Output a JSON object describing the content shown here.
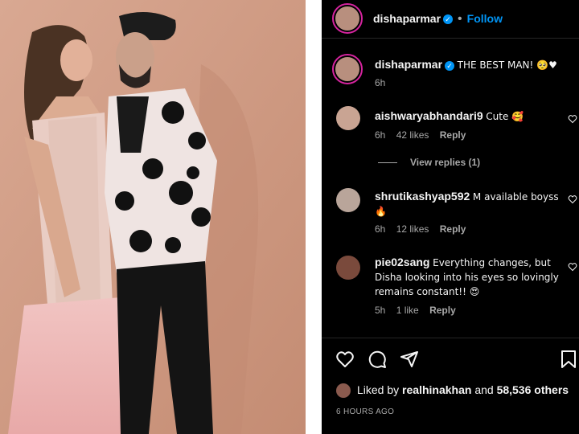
{
  "post": {
    "username": "dishaparmar",
    "follow_label": "Follow",
    "caption": "THE BEST MAN! 🥺♥",
    "caption_time": "6h"
  },
  "comments": [
    {
      "username": "aishwaryabhandari9",
      "text": "Cute 🥰",
      "time": "6h",
      "likes": "42 likes",
      "reply": "Reply"
    },
    {
      "username": "shrutikashyap592",
      "text": "M available boyss 🔥",
      "time": "6h",
      "likes": "12 likes",
      "reply": "Reply"
    },
    {
      "username": "pie02sang",
      "text": "Everything changes, but Disha looking into his eyes so lovingly remains constant!! 😍",
      "time": "5h",
      "likes": "1 like",
      "reply": "Reply"
    }
  ],
  "view_replies": "View replies (1)",
  "liked_by": {
    "prefix": "Liked by",
    "user": "realhinakhan",
    "joiner": "and",
    "others": "58,536 others"
  },
  "timestamp": "6 HOURS AGO",
  "icons": [
    "heart-icon",
    "comment-icon",
    "share-icon",
    "bookmark-icon",
    "verified-badge-icon"
  ]
}
